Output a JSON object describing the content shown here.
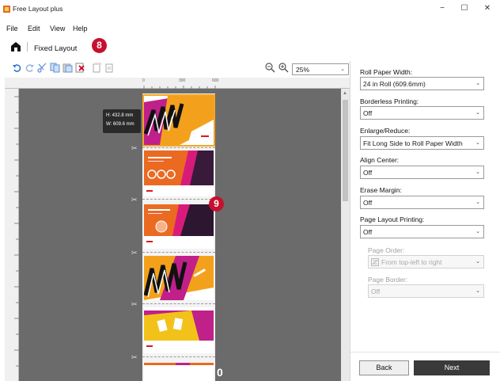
{
  "window": {
    "title": "Free Layout plus",
    "controls": {
      "minimize": "−",
      "maximize": "☐",
      "close": "✕"
    }
  },
  "menu": {
    "items": [
      "File",
      "Edit",
      "View",
      "Help"
    ]
  },
  "mode": {
    "label": "Fixed Layout",
    "badge": "8"
  },
  "toolbar": {
    "icons": [
      "undo-icon",
      "redo-icon",
      "cut-icon",
      "copy-icon",
      "paste-icon",
      "delete-icon",
      "page-icon",
      "page-2-icon"
    ],
    "zoom_value": "25%"
  },
  "ruler": {
    "top_marks": [
      "0",
      "300",
      "600"
    ]
  },
  "canvas": {
    "tooltip": {
      "height": "H: 432.8 mm",
      "width": "W: 609.6 mm"
    },
    "badge": "9",
    "end_marker": "0"
  },
  "settings": {
    "roll_paper_width": {
      "label": "Roll Paper Width:",
      "value": "24 in Roll (609.6mm)"
    },
    "borderless_printing": {
      "label": "Borderless Printing:",
      "value": "Off"
    },
    "enlarge_reduce": {
      "label": "Enlarge/Reduce:",
      "value": "Fit Long Side to Roll Paper Width"
    },
    "align_center": {
      "label": "Align Center:",
      "value": "Off"
    },
    "erase_margin": {
      "label": "Erase Margin:",
      "value": "Off"
    },
    "page_layout_printing": {
      "label": "Page Layout Printing:",
      "value": "Off"
    },
    "page_order": {
      "label": "Page Order:",
      "value": "From top-left to right"
    },
    "page_border": {
      "label": "Page Border:",
      "value": "Off"
    }
  },
  "buttons": {
    "back": "Back",
    "next": "Next"
  },
  "colors": {
    "badge_red": "#c8102e",
    "selection_orange": "#f5a623",
    "canvas_gray": "#6b6b6b",
    "next_button": "#3a3a3a"
  }
}
